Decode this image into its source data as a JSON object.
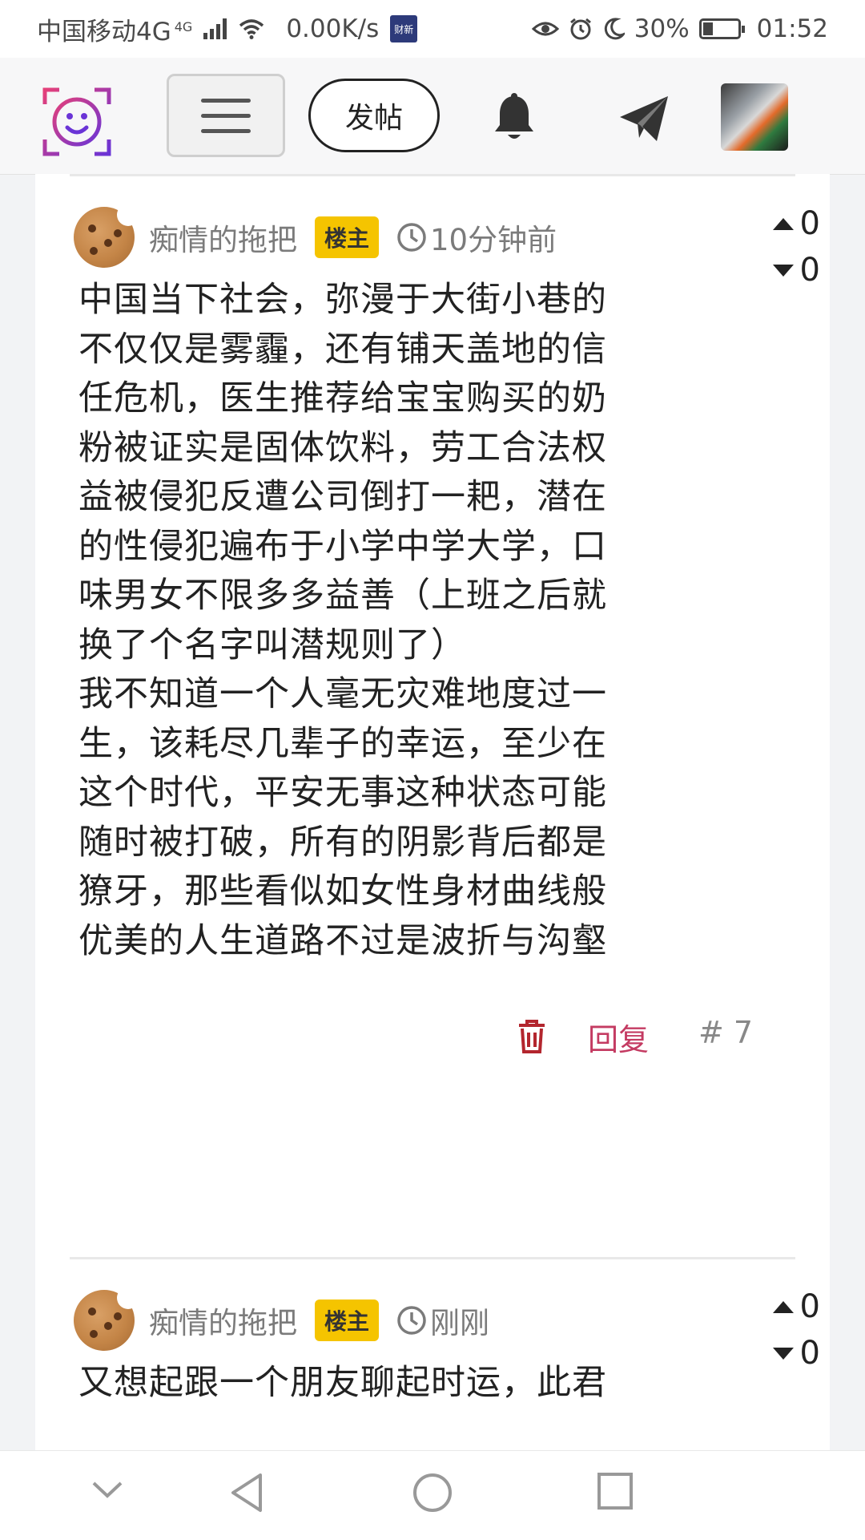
{
  "status_bar": {
    "carrier": "中国移动4G",
    "network_sup": "4G",
    "speed": "0.00K/s",
    "news_badge": "财新",
    "battery": "30%",
    "battery_level": 0.3,
    "time": "01:52"
  },
  "nav": {
    "post_label": "发帖",
    "icons": [
      "logo-icon",
      "menu-icon",
      "bell-icon",
      "send-icon",
      "avatar"
    ]
  },
  "posts": [
    {
      "author": "痴情的拖把",
      "badge": "楼主",
      "time": "10分钟前",
      "upvotes": "0",
      "downvotes": "0",
      "body": "中国当下社会，弥漫于大街小巷的\n不仅仅是雾霾，还有铺天盖地的信\n任危机，医生推荐给宝宝购买的奶\n粉被证实是固体饮料，劳工合法权\n益被侵犯反遭公司倒打一耙，潜在\n的性侵犯遍布于小学中学大学，口\n味男女不限多多益善（上班之后就\n换了个名字叫潜规则了）\n我不知道一个人毫无灾难地度过一\n生，该耗尽几辈子的幸运，至少在\n这个时代，平安无事这种状态可能\n随时被打破，所有的阴影背后都是\n獠牙，那些看似如女性身材曲线般\n优美的人生道路不过是波折与沟壑",
      "reply_label": "回复",
      "floor": "# 7"
    },
    {
      "author": "痴情的拖把",
      "badge": "楼主",
      "time": "刚刚",
      "upvotes": "0",
      "downvotes": "0",
      "body": "又想起跟一个朋友聊起时运，此君"
    }
  ],
  "colors": {
    "accent_reply": "#c43b62",
    "badge_yellow": "#f5c400",
    "trash_red": "#b3262e",
    "logo_pink": "#e4407a",
    "logo_purple": "#6a34d6"
  }
}
